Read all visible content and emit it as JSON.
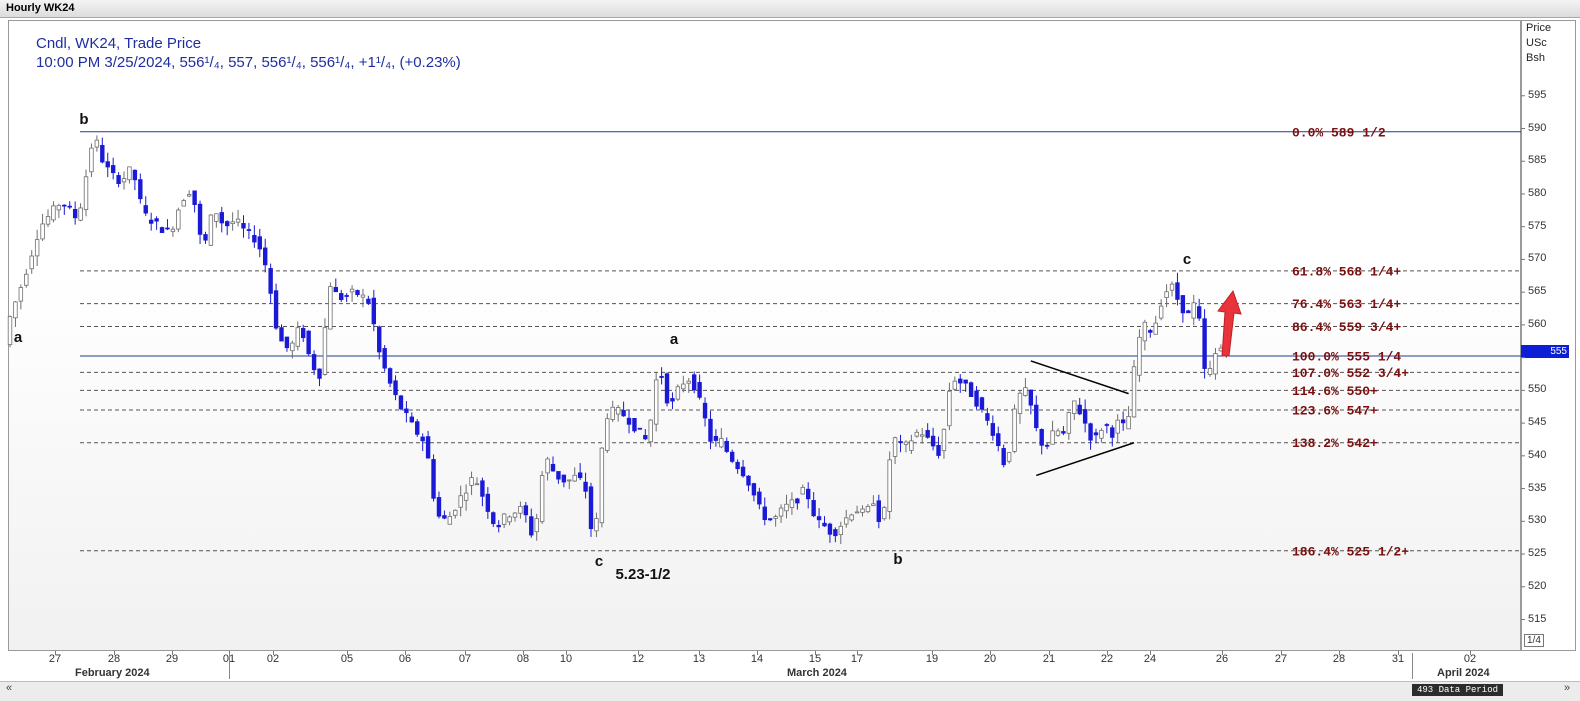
{
  "window": {
    "title": "Hourly WK24"
  },
  "legend": {
    "line1": "Cndl, WK24, Trade Price",
    "line2": "10:00 PM 3/25/2024, 556¹/₄, 557, 556¹/₄, 556¹/₄, +1¹/₄, (+0.23%)"
  },
  "axis": {
    "unit_lines": [
      "Price",
      "USc",
      "Bsh"
    ],
    "current_price_label": "555",
    "page_indicator": "1/4",
    "data_period": "493 Data Period",
    "scroll_left": "«",
    "scroll_right": "»"
  },
  "colors": {
    "candle_down": "#1a1ad6",
    "candle_up": "#6e6e6e",
    "fib_text": "#7a0f0f",
    "legend_text": "#1f2f9f",
    "blue_line": "#1d3d8f",
    "arrow": "#e8333a"
  },
  "chart_data": {
    "type": "candlestick",
    "title": "Hourly WK24",
    "ylabel": "Price USc Bsh",
    "ylim": [
      510.5,
      598
    ],
    "y_ticks": [
      515,
      520,
      525,
      530,
      535,
      540,
      545,
      550,
      555,
      560,
      565,
      570,
      575,
      580,
      585,
      590,
      595
    ],
    "x_ticks": [
      "27",
      "28",
      "29",
      "01",
      "02",
      "05",
      "06",
      "07",
      "08",
      "10",
      "12",
      "13",
      "14",
      "15",
      "17",
      "19",
      "20",
      "21",
      "22",
      "24",
      "26",
      "27",
      "28",
      "31",
      "02"
    ],
    "x_months": [
      "February 2024",
      "March 2024",
      "April 2024"
    ],
    "path": [
      [
        0,
        560
      ],
      [
        3,
        567
      ],
      [
        6,
        575
      ],
      [
        10,
        579
      ],
      [
        13,
        576
      ],
      [
        15,
        585
      ],
      [
        16,
        589.5
      ],
      [
        17,
        586
      ],
      [
        19,
        583
      ],
      [
        21,
        582
      ],
      [
        23,
        584
      ],
      [
        25,
        577
      ],
      [
        28,
        575
      ],
      [
        30,
        574
      ],
      [
        32,
        579
      ],
      [
        34,
        581
      ],
      [
        35,
        576
      ],
      [
        36,
        571
      ],
      [
        38,
        578
      ],
      [
        40,
        575
      ],
      [
        42,
        576
      ],
      [
        44,
        574
      ],
      [
        46,
        573
      ],
      [
        48,
        568
      ],
      [
        49,
        562
      ],
      [
        50,
        558
      ],
      [
        52,
        556
      ],
      [
        54,
        560
      ],
      [
        56,
        554
      ],
      [
        58,
        552
      ],
      [
        59,
        567
      ],
      [
        61,
        564
      ],
      [
        64,
        565
      ],
      [
        66,
        564
      ],
      [
        67,
        563
      ],
      [
        68,
        557
      ],
      [
        70,
        552
      ],
      [
        72,
        548
      ],
      [
        75,
        544
      ],
      [
        77,
        542
      ],
      [
        78,
        537
      ],
      [
        79,
        531
      ],
      [
        81,
        530
      ],
      [
        83,
        533
      ],
      [
        86,
        537
      ],
      [
        88,
        533
      ],
      [
        90,
        529
      ],
      [
        92,
        531
      ],
      [
        95,
        532
      ],
      [
        97,
        527
      ],
      [
        98,
        534
      ],
      [
        99,
        540
      ],
      [
        101,
        537
      ],
      [
        103,
        536
      ],
      [
        105,
        537
      ],
      [
        107,
        534
      ],
      [
        108,
        524
      ],
      [
        109,
        536
      ],
      [
        110,
        546
      ],
      [
        112,
        547
      ],
      [
        114,
        546
      ],
      [
        116,
        544
      ],
      [
        118,
        542
      ],
      [
        119,
        549
      ],
      [
        120,
        554
      ],
      [
        122,
        547
      ],
      [
        124,
        551
      ],
      [
        126,
        552
      ],
      [
        128,
        547
      ],
      [
        130,
        541
      ],
      [
        131,
        543
      ],
      [
        133,
        540
      ],
      [
        136,
        537
      ],
      [
        137,
        535
      ],
      [
        139,
        531
      ],
      [
        141,
        530
      ],
      [
        143,
        532
      ],
      [
        145,
        533
      ],
      [
        147,
        535
      ],
      [
        149,
        530
      ],
      [
        151,
        529
      ],
      [
        152,
        528
      ],
      [
        154,
        530
      ],
      [
        156,
        532
      ],
      [
        158,
        531
      ],
      [
        160,
        534
      ],
      [
        161,
        527
      ],
      [
        162,
        536
      ],
      [
        163,
        543
      ],
      [
        165,
        541
      ],
      [
        168,
        544
      ],
      [
        170,
        542
      ],
      [
        171,
        541
      ],
      [
        172,
        540
      ],
      [
        173,
        548
      ],
      [
        174,
        552
      ],
      [
        176,
        551
      ],
      [
        178,
        549
      ],
      [
        180,
        546
      ],
      [
        182,
        543
      ],
      [
        183,
        540
      ],
      [
        184,
        538
      ],
      [
        185,
        544
      ],
      [
        186,
        549
      ],
      [
        188,
        550
      ],
      [
        189,
        545
      ],
      [
        191,
        541
      ],
      [
        193,
        544
      ],
      [
        195,
        543
      ],
      [
        196,
        549
      ],
      [
        198,
        546
      ],
      [
        200,
        542
      ],
      [
        202,
        545
      ],
      [
        204,
        543
      ],
      [
        205,
        547
      ],
      [
        206,
        542
      ],
      [
        207,
        550
      ],
      [
        208,
        556
      ],
      [
        209,
        560
      ],
      [
        211,
        559
      ],
      [
        213,
        565
      ],
      [
        215,
        566
      ],
      [
        216,
        562
      ],
      [
        217,
        563
      ],
      [
        218,
        560
      ],
      [
        219,
        566
      ],
      [
        220,
        555
      ],
      [
        221,
        551
      ],
      [
        222,
        555
      ],
      [
        223,
        556
      ],
      [
        224,
        557
      ]
    ],
    "fibonacci_levels": [
      {
        "label": "0.0%   589 1/2",
        "price": 589.5
      },
      {
        "label": "61.8%  568 1/4+",
        "price": 568.25
      },
      {
        "label": "76.4%  563 1/4+",
        "price": 563.25
      },
      {
        "label": "86.4%  559 3/4+",
        "price": 559.75
      },
      {
        "label": "100.0% 555 1/4",
        "price": 555.25
      },
      {
        "label": "107.0% 552 3/4+",
        "price": 552.75
      },
      {
        "label": "114.6% 550+",
        "price": 550
      },
      {
        "label": "123.6% 547+",
        "price": 547
      },
      {
        "label": "138.2% 542+",
        "price": 542
      },
      {
        "label": "186.4% 525 1/2+",
        "price": 525.5
      }
    ],
    "wave_labels": [
      {
        "text": "a",
        "bar": 1,
        "price": 560
      },
      {
        "text": "b",
        "bar": 16,
        "price": 589.5
      },
      {
        "text": "a",
        "bar": 120,
        "price": 556
      },
      {
        "text": "c",
        "bar": 108,
        "price": 524
      },
      {
        "text": "5.23-1/2",
        "bar": 108,
        "price": 524
      },
      {
        "text": "b",
        "bar": 161,
        "price": 527
      },
      {
        "text": "c",
        "bar": 216,
        "price": 567
      }
    ],
    "triangle": {
      "upper": [
        [
          188,
          554.5
        ],
        [
          206,
          549.5
        ]
      ],
      "lower": [
        [
          189,
          537
        ],
        [
          207,
          542
        ]
      ]
    }
  }
}
